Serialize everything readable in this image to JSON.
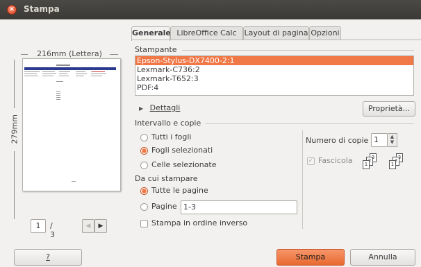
{
  "window": {
    "title": "Stampa"
  },
  "preview": {
    "width_label": "216mm (Lettera)",
    "height_label": "279mm",
    "current_page": "1",
    "total_pages": "/ 3"
  },
  "tabs": [
    {
      "label": "Generale",
      "active": true
    },
    {
      "label": "LibreOffice Calc",
      "active": false
    },
    {
      "label": "Layout di pagina",
      "active": false
    },
    {
      "label": "Opzioni",
      "active": false
    }
  ],
  "printer": {
    "section_label": "Stampante",
    "printers": [
      "Epson-Stylus-DX7400-2:1",
      "Lexmark-C736:2",
      "Lexmark-T652:3",
      "PDF:4"
    ],
    "selected_index": 0,
    "details_label": "Dettagli",
    "properties_button": "Proprietà..."
  },
  "range": {
    "section_label": "Intervallo e copie",
    "options": [
      {
        "label": "Tutti i fogli",
        "selected": false
      },
      {
        "label": "Fogli selezionati",
        "selected": true
      },
      {
        "label": "Celle selezionate",
        "selected": false
      }
    ],
    "from_label": "Da cui stampare",
    "from_options": [
      {
        "label": "Tutte le pagine",
        "selected": true
      },
      {
        "label": "Pagine",
        "selected": false
      }
    ],
    "pages_value": "1-3",
    "reverse_label": "Stampa in ordine inverso",
    "reverse_checked": false
  },
  "copies": {
    "label": "Numero di copie",
    "value": "1",
    "collate_label": "Fascicola",
    "collate_checked": true
  },
  "footer": {
    "help_button": "?",
    "print_button": "Stampa",
    "cancel_button": "Annulla"
  },
  "colors": {
    "accent": "#f07746",
    "titlebar": "#3c3b37"
  }
}
